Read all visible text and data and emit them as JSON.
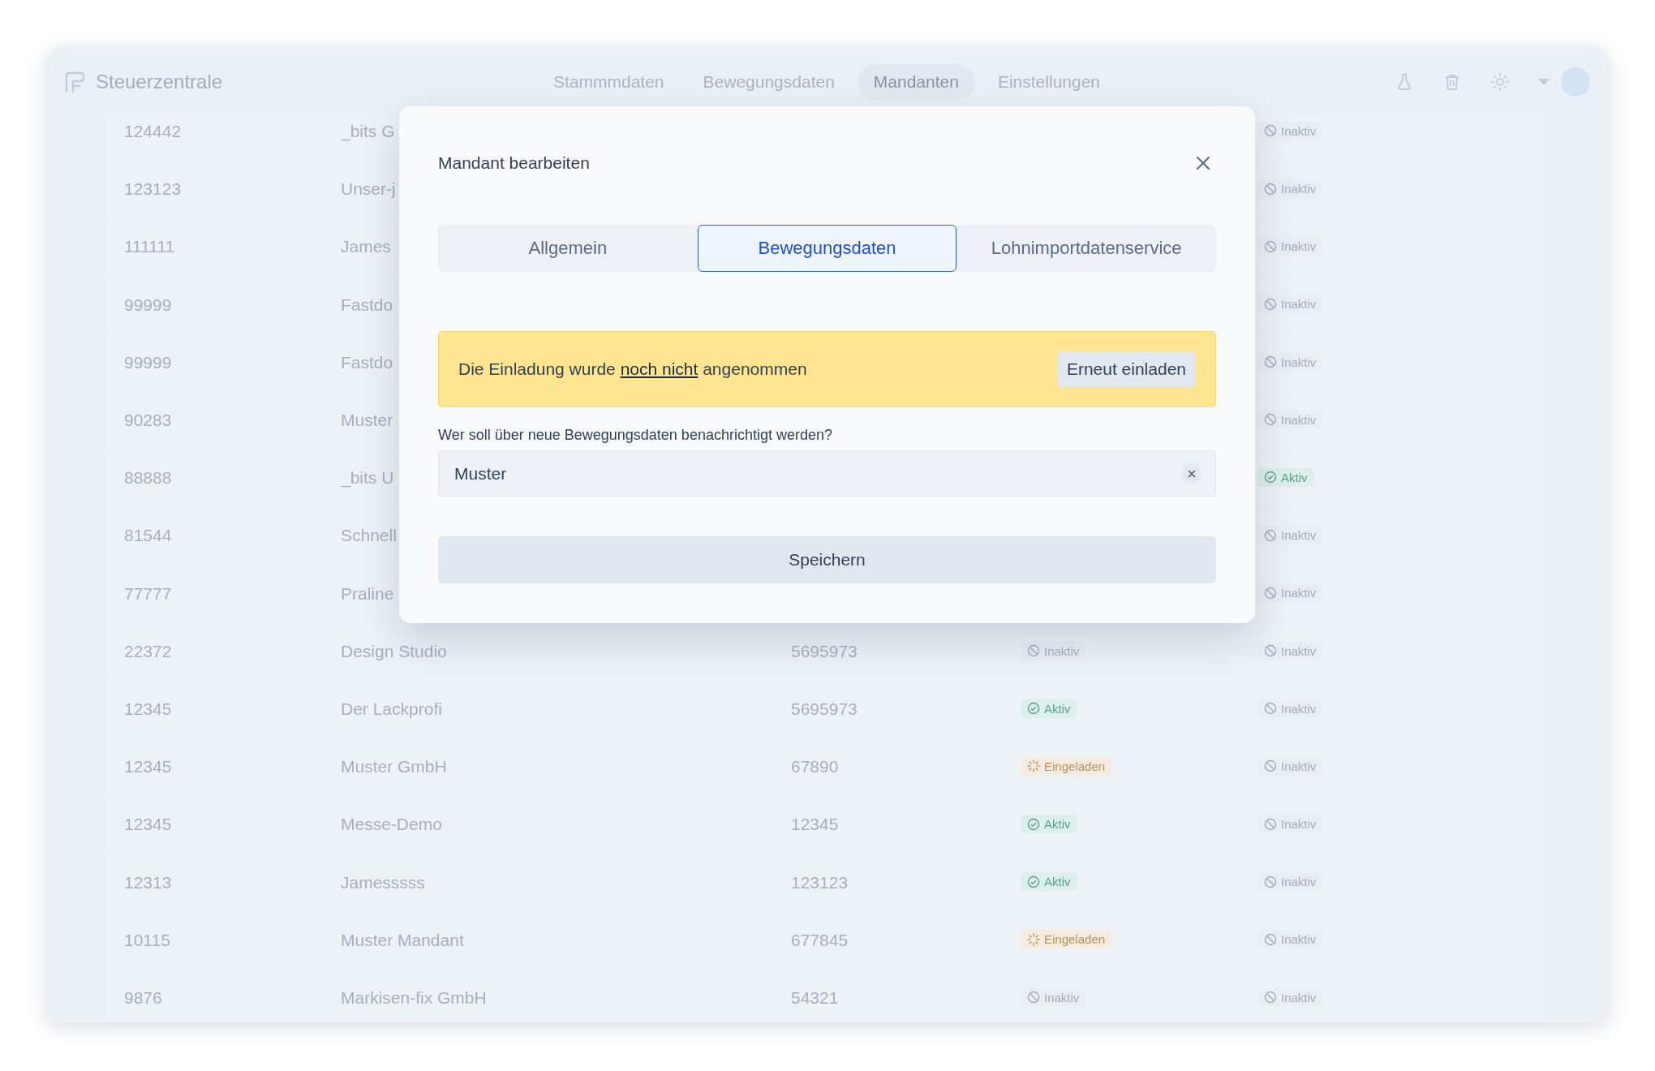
{
  "app": {
    "title": "Steuerzentrale"
  },
  "nav": [
    {
      "label": "Stammmdaten",
      "selected": false
    },
    {
      "label": "Bewegungsdaten",
      "selected": false
    },
    {
      "label": "Mandanten",
      "selected": true
    },
    {
      "label": "Einstellungen",
      "selected": false
    }
  ],
  "table": {
    "rows": [
      {
        "column_1": "124442",
        "column_2": "_bits G",
        "column_5": {
          "label": "Inaktiv",
          "kind": "inactive"
        }
      },
      {
        "column_1": "123123",
        "column_2": "Unser-j",
        "column_5": {
          "label": "Inaktiv",
          "kind": "inactive"
        }
      },
      {
        "column_1": "111111",
        "column_2": "James",
        "column_5": {
          "label": "Inaktiv",
          "kind": "inactive"
        }
      },
      {
        "column_1": "99999",
        "column_2": "Fastdo",
        "column_5": {
          "label": "Inaktiv",
          "kind": "inactive"
        }
      },
      {
        "column_1": "99999",
        "column_2": "Fastdo",
        "column_5": {
          "label": "Inaktiv",
          "kind": "inactive"
        }
      },
      {
        "column_1": "90283",
        "column_2": "Muster",
        "column_5": {
          "label": "Inaktiv",
          "kind": "inactive"
        }
      },
      {
        "column_1": "88888",
        "column_2": "_bits U",
        "column_5": {
          "label": "Aktiv",
          "kind": "active"
        }
      },
      {
        "column_1": "81544",
        "column_2": "Schnell",
        "column_5": {
          "label": "Inaktiv",
          "kind": "inactive"
        }
      },
      {
        "column_1": "77777",
        "column_2": "Praline",
        "column_5": {
          "label": "Inaktiv",
          "kind": "inactive"
        }
      },
      {
        "column_1": "22372",
        "column_2": "Design Studio",
        "column_3": "5695973",
        "column_4": {
          "label": "Inaktiv",
          "kind": "inactive"
        },
        "column_5": {
          "label": "Inaktiv",
          "kind": "inactive"
        }
      },
      {
        "column_1": "12345",
        "column_2": "Der Lackprofi",
        "column_3": "5695973",
        "column_4": {
          "label": "Aktiv",
          "kind": "active"
        },
        "column_5": {
          "label": "Inaktiv",
          "kind": "inactive"
        }
      },
      {
        "column_1": "12345",
        "column_2": "Muster GmbH",
        "column_3": "67890",
        "column_4": {
          "label": "Eingeladen",
          "kind": "invited"
        },
        "column_5": {
          "label": "Inaktiv",
          "kind": "inactive"
        }
      },
      {
        "column_1": "12345",
        "column_2": "Messe-Demo",
        "column_3": "12345",
        "column_4": {
          "label": "Aktiv",
          "kind": "active"
        },
        "column_5": {
          "label": "Inaktiv",
          "kind": "inactive"
        }
      },
      {
        "column_1": "12313",
        "column_2": "Jamesssss",
        "column_3": "123123",
        "column_4": {
          "label": "Aktiv",
          "kind": "active"
        },
        "column_5": {
          "label": "Inaktiv",
          "kind": "inactive"
        }
      },
      {
        "column_1": "10115",
        "column_2": "Muster Mandant",
        "column_3": "677845",
        "column_4": {
          "label": "Eingeladen",
          "kind": "invited"
        },
        "column_5": {
          "label": "Inaktiv",
          "kind": "inactive"
        }
      },
      {
        "column_1": "9876",
        "column_2": "Markisen-fix GmbH",
        "column_3": "54321",
        "column_4": {
          "label": "Inaktiv",
          "kind": "inactive"
        },
        "column_5": {
          "label": "Inaktiv",
          "kind": "inactive"
        }
      }
    ]
  },
  "dialog": {
    "title": "Mandant bearbeiten",
    "tabs": [
      {
        "label": "Allgemein",
        "selected": false
      },
      {
        "label": "Bewegungsdaten",
        "selected": true
      },
      {
        "label": "Lohnimportdatenservice",
        "selected": false
      }
    ],
    "alert": {
      "text_start": "Die Einladung wurde",
      "link": "noch nicht",
      "text_end": "angenommen",
      "button": "Erneut einladen"
    },
    "field": {
      "label": "Wer soll über neue Bewegungsdaten benachrichtigt werden?",
      "value": "Muster"
    },
    "save_button": "Speichern"
  }
}
